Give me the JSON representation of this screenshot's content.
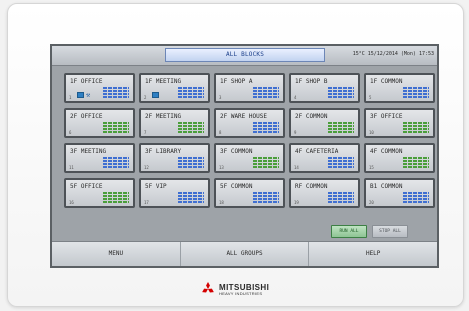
{
  "header": {
    "title": "ALL BLOCKS",
    "status": "15°C 15/12/2014 (Mon) 17:53"
  },
  "tiles": [
    {
      "name": "1F OFFICE",
      "num": "1",
      "icons": [
        "unit-icon",
        "wrench-icon"
      ],
      "bars": [
        "#3f6fd1",
        "#3f6fd1",
        "#3f6fd1",
        "#3f6fd1"
      ]
    },
    {
      "name": "1F MEETING",
      "num": "2",
      "icons": [
        "unit-icon"
      ],
      "bars": [
        "#3f6fd1",
        "#3f6fd1",
        "#3f6fd1",
        "#3f6fd1"
      ]
    },
    {
      "name": "1F SHOP A",
      "num": "3",
      "icons": [],
      "bars": [
        "#3f6fd1",
        "#3f6fd1",
        "#3f6fd1",
        "#3f6fd1"
      ]
    },
    {
      "name": "1F SHOP B",
      "num": "4",
      "icons": [],
      "bars": [
        "#3f6fd1",
        "#3f6fd1",
        "#3f6fd1",
        "#3f6fd1"
      ]
    },
    {
      "name": "1F COMMON",
      "num": "5",
      "icons": [],
      "bars": [
        "#3f6fd1",
        "#3f6fd1",
        "#3f6fd1",
        "#3f6fd1"
      ]
    },
    {
      "name": "2F OFFICE",
      "num": "6",
      "icons": [],
      "bars": [
        "#4a9e3a",
        "#4a9e3a",
        "#4a9e3a",
        "#4a9e3a"
      ]
    },
    {
      "name": "2F MEETING",
      "num": "7",
      "icons": [],
      "bars": [
        "#4a9e3a",
        "#4a9e3a",
        "#4a9e3a",
        "#4a9e3a"
      ]
    },
    {
      "name": "2F WARE HOUSE",
      "num": "8",
      "icons": [],
      "bars": [
        "#3f6fd1",
        "#3f6fd1",
        "#3f6fd1",
        "#3f6fd1"
      ]
    },
    {
      "name": "2F COMMON",
      "num": "9",
      "icons": [],
      "bars": [
        "#4a9e3a",
        "#4a9e3a",
        "#4a9e3a",
        "#4a9e3a"
      ]
    },
    {
      "name": "3F OFFICE",
      "num": "10",
      "icons": [],
      "bars": [
        "#4a9e3a",
        "#4a9e3a",
        "#4a9e3a",
        "#4a9e3a"
      ]
    },
    {
      "name": "3F MEETING",
      "num": "11",
      "icons": [],
      "bars": [
        "#3f6fd1",
        "#3f6fd1",
        "#3f6fd1",
        "#3f6fd1"
      ]
    },
    {
      "name": "3F LIBRARY",
      "num": "12",
      "icons": [],
      "bars": [
        "#3f6fd1",
        "#3f6fd1",
        "#3f6fd1",
        "#3f6fd1"
      ]
    },
    {
      "name": "3F COMMON",
      "num": "13",
      "icons": [],
      "bars": [
        "#4a9e3a",
        "#4a9e3a",
        "#4a9e3a",
        "#4a9e3a"
      ]
    },
    {
      "name": "4F CAFETERIA",
      "num": "14",
      "icons": [],
      "bars": [
        "#3f6fd1",
        "#3f6fd1",
        "#3f6fd1",
        "#3f6fd1"
      ]
    },
    {
      "name": "4F COMMON",
      "num": "15",
      "icons": [],
      "bars": [
        "#4a9e3a",
        "#4a9e3a",
        "#4a9e3a",
        "#4a9e3a"
      ]
    },
    {
      "name": "5F OFFICE",
      "num": "16",
      "icons": [],
      "bars": [
        "#4a9e3a",
        "#4a9e3a",
        "#4a9e3a",
        "#4a9e3a"
      ]
    },
    {
      "name": "5F VIP",
      "num": "17",
      "icons": [],
      "bars": [
        "#3f6fd1",
        "#3f6fd1",
        "#3f6fd1",
        "#3f6fd1"
      ]
    },
    {
      "name": "5F COMMON",
      "num": "18",
      "icons": [],
      "bars": [
        "#3f6fd1",
        "#3f6fd1",
        "#3f6fd1",
        "#3f6fd1"
      ]
    },
    {
      "name": "RF COMMON",
      "num": "19",
      "icons": [],
      "bars": [
        "#3f6fd1",
        "#3f6fd1",
        "#3f6fd1",
        "#3f6fd1"
      ]
    },
    {
      "name": "B1 COMMON",
      "num": "20",
      "icons": [],
      "bars": [
        "#3f6fd1",
        "#3f6fd1",
        "#3f6fd1",
        "#3f6fd1"
      ]
    }
  ],
  "actions": {
    "run_all": "RUN ALL",
    "stop_all": "STOP ALL"
  },
  "nav": {
    "menu": "MENU",
    "all_groups": "ALL GROUPS",
    "help": "HELP"
  },
  "brand": {
    "name": "MITSUBISHI",
    "sub": "HEAVY INDUSTRIES",
    "color": "#d40000"
  }
}
